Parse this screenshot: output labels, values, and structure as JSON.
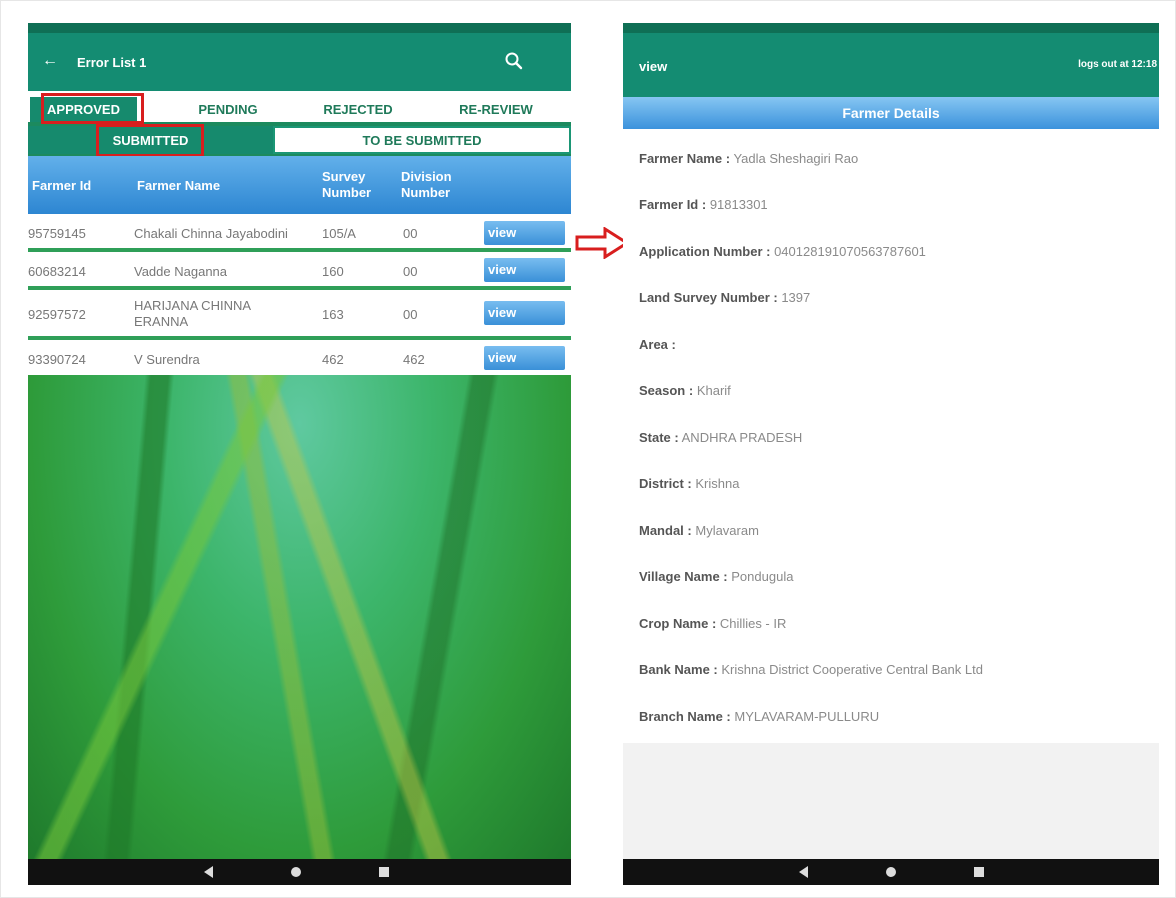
{
  "left": {
    "title": "Error List 1",
    "icons": {
      "back": "back-arrow-icon",
      "search": "search-icon"
    },
    "tabs_primary": [
      {
        "label": "APPROVED",
        "active": true
      },
      {
        "label": "PENDING",
        "active": false
      },
      {
        "label": "REJECTED",
        "active": false
      },
      {
        "label": "RE-REVIEW",
        "active": false
      }
    ],
    "tabs_secondary": [
      {
        "label": "SUBMITTED",
        "active": true
      },
      {
        "label": "TO BE SUBMITTED",
        "active": false
      }
    ],
    "table": {
      "headers": {
        "farmer_id": "Farmer Id",
        "farmer_name": "Farmer Name",
        "survey_1": "Survey",
        "survey_2": "Number",
        "division_1": "Division",
        "division_2": "Number"
      },
      "rows": [
        {
          "farmer_id": "95759145",
          "farmer_name": "Chakali Chinna Jayabodini",
          "farmer_name_2": "",
          "survey": "105/A",
          "division": "00",
          "action": "view"
        },
        {
          "farmer_id": "60683214",
          "farmer_name": "Vadde Naganna",
          "farmer_name_2": "",
          "survey": "160",
          "division": "00",
          "action": "view"
        },
        {
          "farmer_id": "92597572",
          "farmer_name": "HARIJANA CHINNA",
          "farmer_name_2": "ERANNA",
          "survey": "163",
          "division": "00",
          "action": "view"
        },
        {
          "farmer_id": "93390724",
          "farmer_name": "V Surendra",
          "farmer_name_2": "",
          "survey": "462",
          "division": "462",
          "action": "view"
        }
      ]
    }
  },
  "right": {
    "title": "view",
    "logout_text": "logs out at 12:18",
    "section_title": "Farmer Details",
    "details": [
      {
        "label": "Farmer Name :",
        "value": "Yadla Sheshagiri Rao"
      },
      {
        "label": "Farmer Id :",
        "value": "91813301"
      },
      {
        "label": "Application Number :",
        "value": "040128191070563787601"
      },
      {
        "label": "Land Survey Number :",
        "value": "1397"
      },
      {
        "label": "Area :",
        "value": ""
      },
      {
        "label": "Season :",
        "value": "Kharif"
      },
      {
        "label": "State :",
        "value": "ANDHRA PRADESH"
      },
      {
        "label": "District :",
        "value": "Krishna"
      },
      {
        "label": "Mandal :",
        "value": "Mylavaram"
      },
      {
        "label": "Village Name :",
        "value": "Pondugula"
      },
      {
        "label": "Crop Name :",
        "value": "Chillies - IR"
      },
      {
        "label": "Bank Name :",
        "value": "Krishna District Cooperative Central Bank Ltd"
      },
      {
        "label": "Branch Name :",
        "value": "MYLAVARAM-PULLURU"
      }
    ]
  },
  "annotation": {
    "highlight_color": "#d81e1e",
    "arrow": "right-arrow-icon"
  },
  "colors": {
    "appbar": "#148c72",
    "tab_active": "#168a6d",
    "header_blue": "#3b92dc"
  }
}
